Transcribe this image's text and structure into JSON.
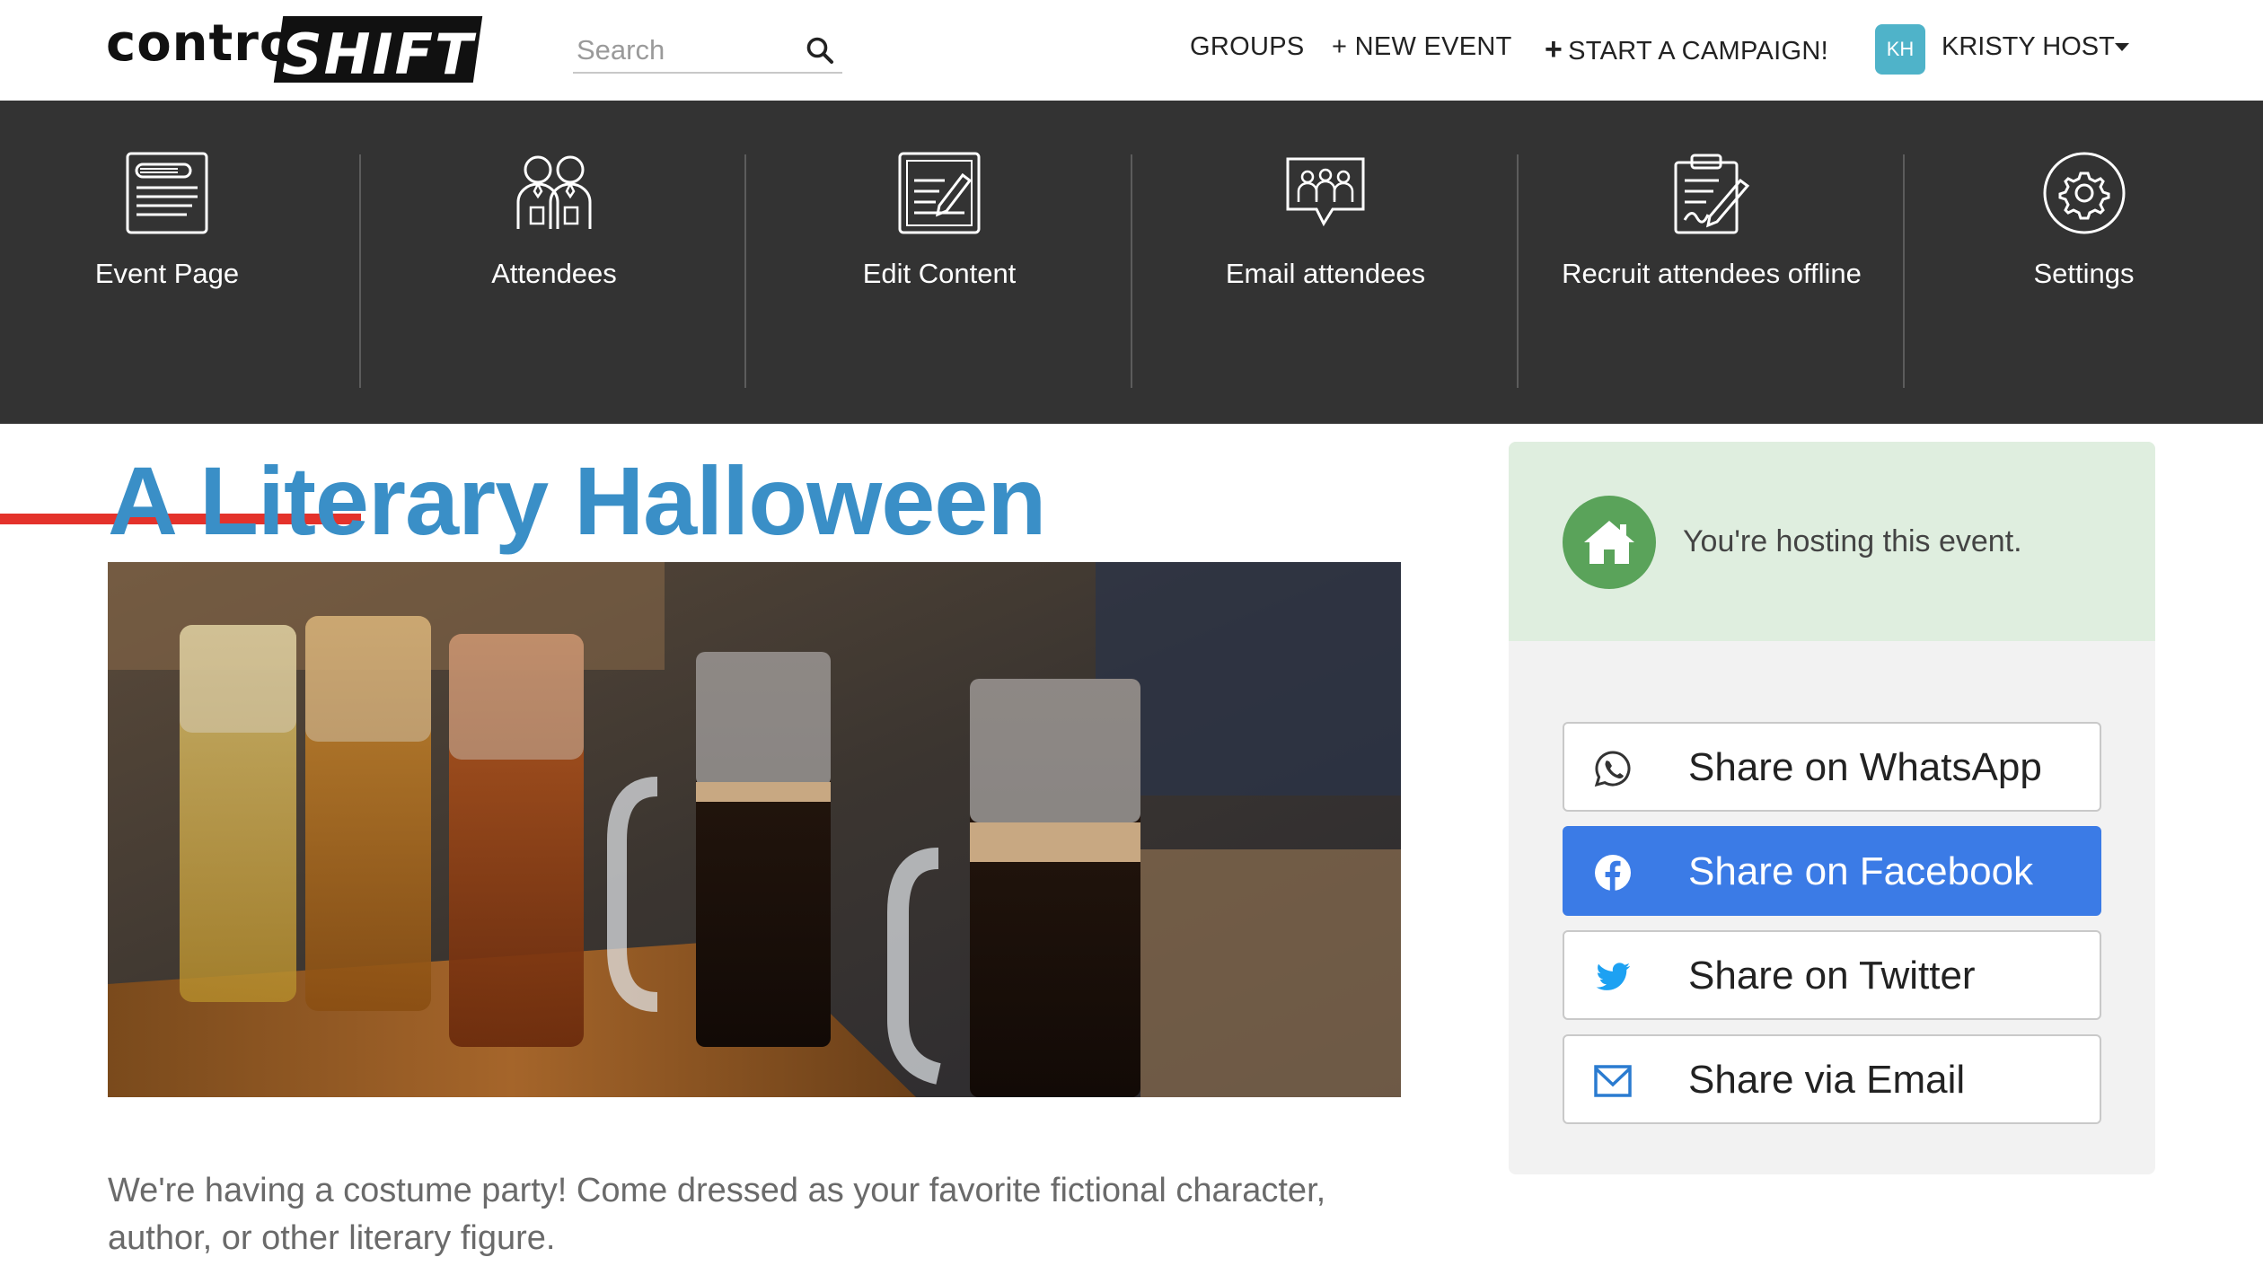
{
  "header": {
    "logo_part1": "control",
    "logo_part2": "SHIFT",
    "search_placeholder": "Search",
    "nav": {
      "groups": "GROUPS",
      "new_event": "+ NEW EVENT",
      "campaign_plus": "+",
      "campaign": "START A CAMPAIGN!"
    },
    "user": {
      "initials": "KH",
      "name": "KRISTY HOST",
      "avatar_color": "#4fb3c9"
    }
  },
  "toolnav": {
    "background": "#333333",
    "active_color": "#e4322b",
    "active_index": 0,
    "items": [
      {
        "label": "Event Page",
        "icon": "event-page-icon"
      },
      {
        "label": "Attendees",
        "icon": "attendees-icon"
      },
      {
        "label": "Edit Content",
        "icon": "edit-content-icon"
      },
      {
        "label": "Email attendees",
        "icon": "email-attendees-icon"
      },
      {
        "label": "Recruit attendees offline",
        "icon": "clipboard-icon"
      },
      {
        "label": "Settings",
        "icon": "gear-icon"
      }
    ]
  },
  "event": {
    "title": "A Literary Halloween",
    "title_color": "#3a8fc7",
    "image_subject": "beer-flight-photo",
    "description": "We're having a costume party! Come dressed as your favorite fictional character, author, or other literary figure."
  },
  "sidebar": {
    "host_message": "You're hosting this event.",
    "host_icon": "house-icon",
    "share_buttons": [
      {
        "label": "Share on WhatsApp",
        "icon": "whatsapp-icon"
      },
      {
        "label": "Share on Facebook",
        "icon": "facebook-icon",
        "color": "#3b7be6"
      },
      {
        "label": "Share on Twitter",
        "icon": "twitter-icon"
      },
      {
        "label": "Share via Email",
        "icon": "email-icon"
      }
    ]
  }
}
